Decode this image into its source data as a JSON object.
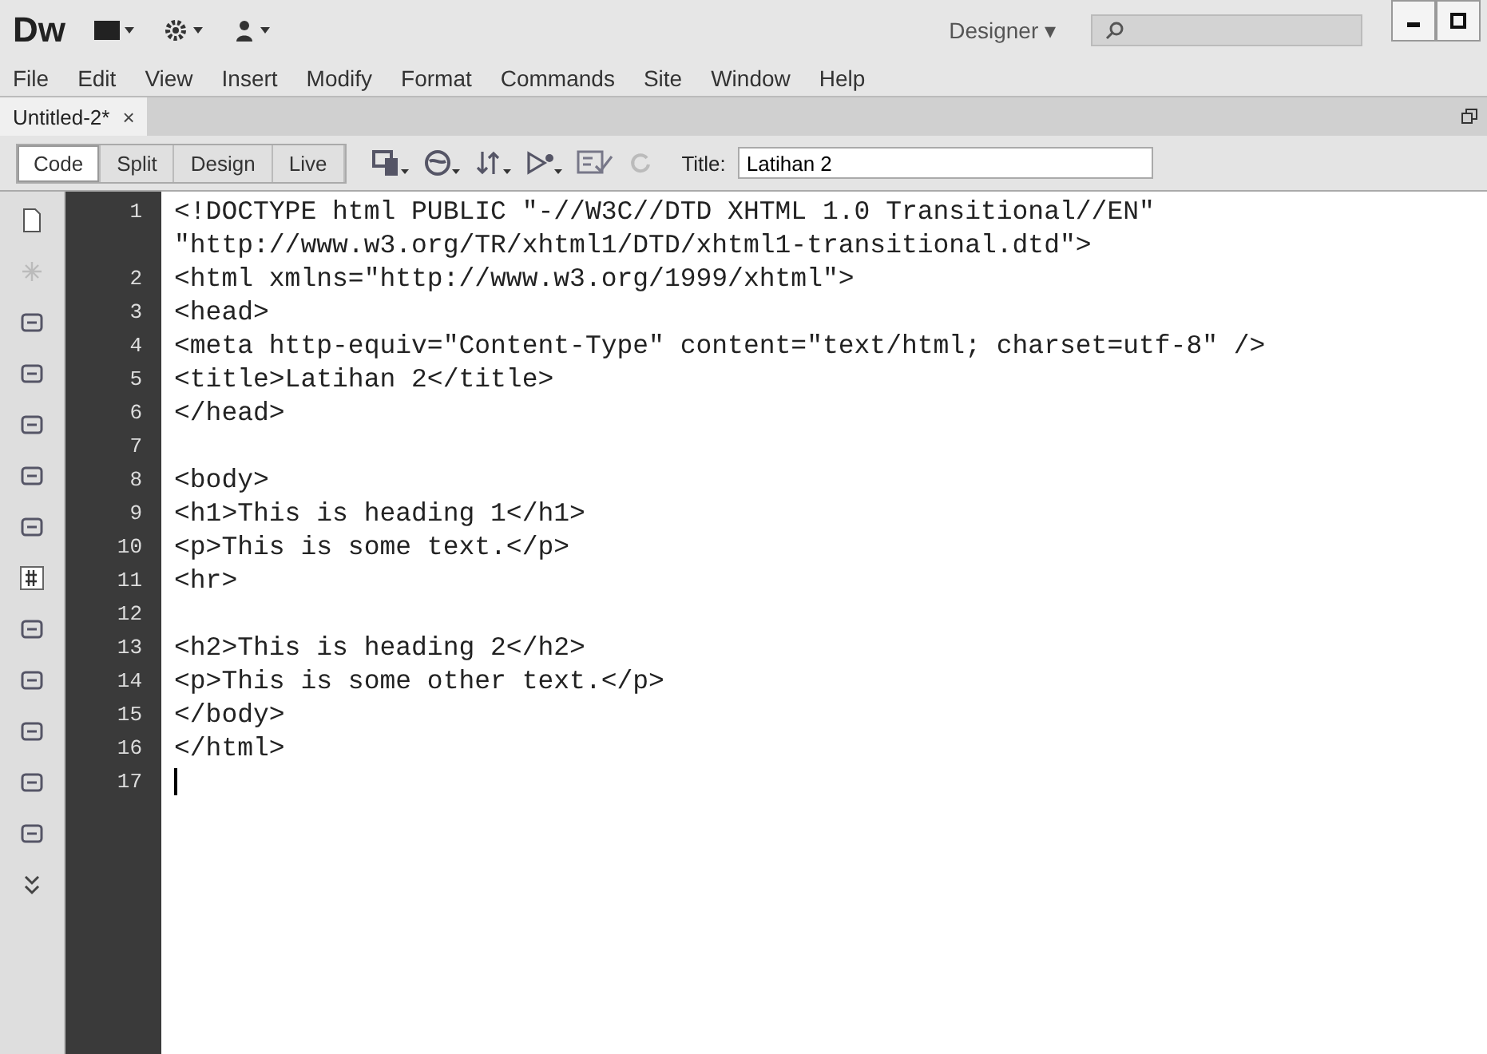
{
  "app": {
    "logo": "Dw",
    "workspace": "Designer",
    "workspace_caret": "▾"
  },
  "menu": [
    "File",
    "Edit",
    "View",
    "Insert",
    "Modify",
    "Format",
    "Commands",
    "Site",
    "Window",
    "Help"
  ],
  "document_tabs": [
    {
      "label": "Untitled-2*",
      "close": "×",
      "selected": true
    }
  ],
  "view_buttons": [
    {
      "label": "Code",
      "selected": true
    },
    {
      "label": "Split",
      "selected": false
    },
    {
      "label": "Design",
      "selected": false
    },
    {
      "label": "Live",
      "selected": false
    }
  ],
  "title_field": {
    "label": "Title:",
    "value": "Latihan 2"
  },
  "code_lines": [
    {
      "number": "1",
      "text": [
        "<!DOCTYPE html PUBLIC \"-//W3C//DTD XHTML 1.0 Transitional//EN\"",
        "\"http://www.w3.org/TR/xhtml1/DTD/xhtml1-transitional.dtd\">"
      ],
      "cursor": false
    },
    {
      "number": "2",
      "text": [
        "<html xmlns=\"http://www.w3.org/1999/xhtml\">"
      ],
      "cursor": false
    },
    {
      "number": "3",
      "text": [
        "<head>"
      ],
      "cursor": false
    },
    {
      "number": "4",
      "text": [
        "<meta http-equiv=\"Content-Type\" content=\"text/html; charset=utf-8\" />"
      ],
      "cursor": false
    },
    {
      "number": "5",
      "text": [
        "<title>Latihan 2</title>"
      ],
      "cursor": false
    },
    {
      "number": "6",
      "text": [
        "</head>"
      ],
      "cursor": false
    },
    {
      "number": "7",
      "cursor": false
    },
    {
      "number": "8",
      "text": [
        "<body>"
      ],
      "cursor": false
    },
    {
      "number": "9",
      "text": [
        "<h1>This is heading 1</h1>"
      ],
      "cursor": false
    },
    {
      "number": "10",
      "text": [
        "<p>This is some text.</p>"
      ],
      "cursor": false
    },
    {
      "number": "11",
      "text": [
        "<hr>"
      ],
      "cursor": false
    },
    {
      "number": "12",
      "cursor": false
    },
    {
      "number": "13",
      "text": [
        "<h2>This is heading 2</h2>"
      ],
      "cursor": false
    },
    {
      "number": "14",
      "text": [
        "<p>This is some other text.</p>"
      ],
      "cursor": false
    },
    {
      "number": "15",
      "text": [
        "</body>"
      ],
      "cursor": false
    },
    {
      "number": "16",
      "text": [
        "</html>"
      ],
      "cursor": false
    },
    {
      "number": "17",
      "cursor": true
    }
  ]
}
